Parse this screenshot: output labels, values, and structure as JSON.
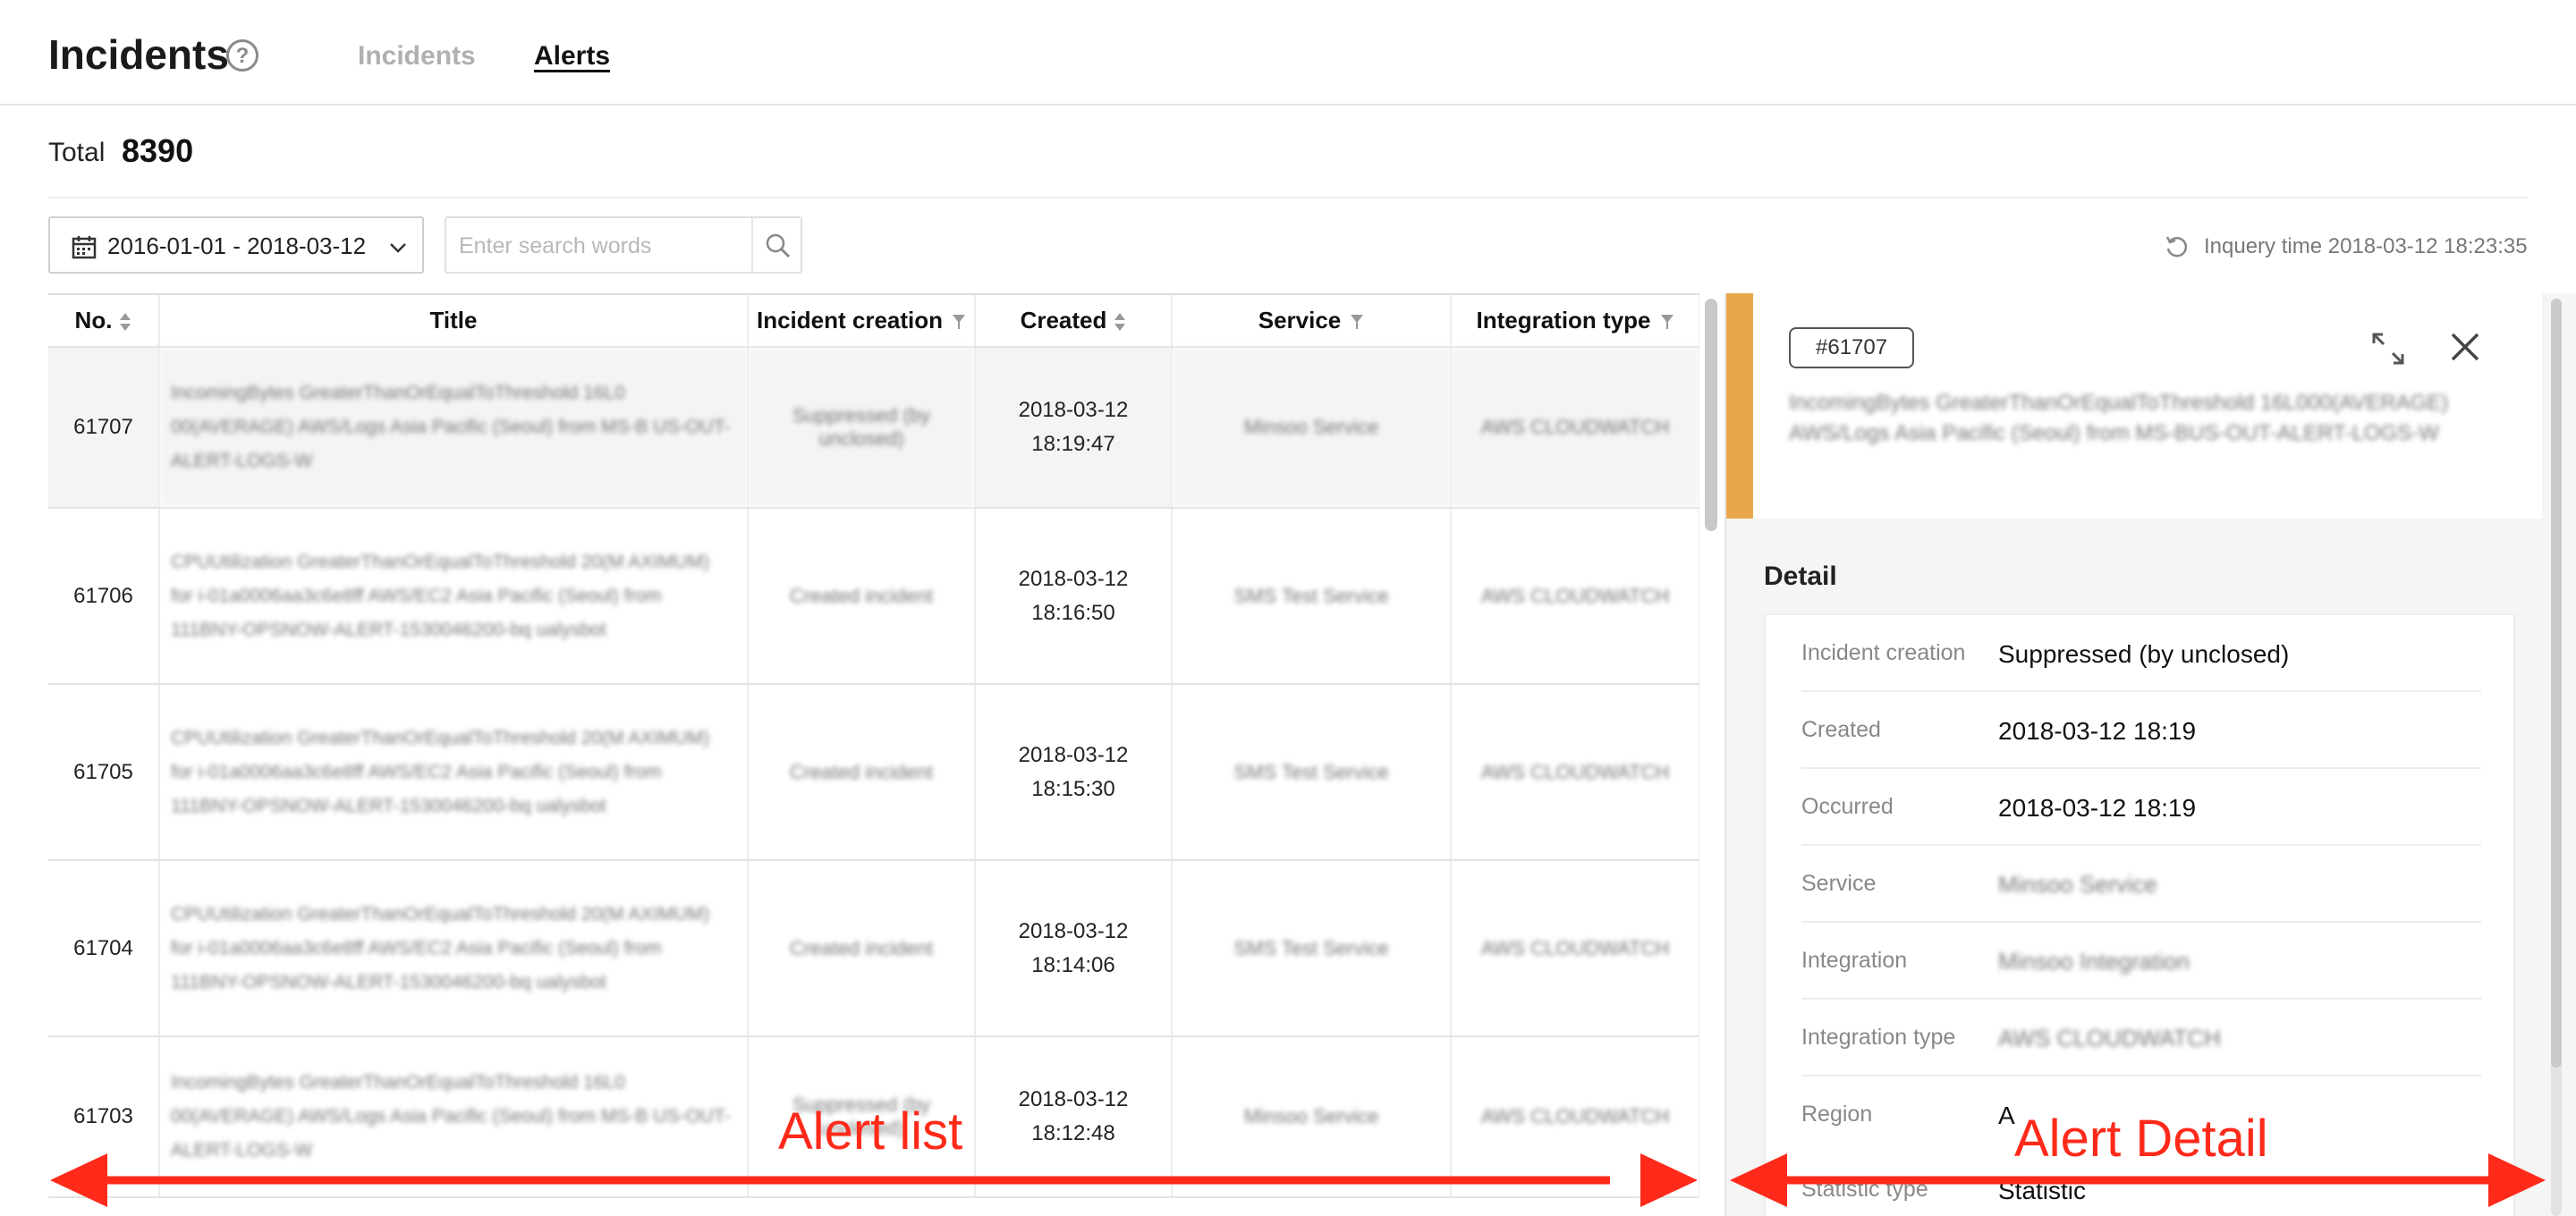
{
  "header": {
    "title": "Incidents",
    "help_icon": "?",
    "tabs": [
      {
        "label": "Incidents",
        "active": false
      },
      {
        "label": "Alerts",
        "active": true
      }
    ]
  },
  "total": {
    "label": "Total",
    "value": "8390"
  },
  "filters": {
    "date_range": "2016-01-01 - 2018-03-12",
    "search_placeholder": "Enter search words",
    "inquiry_time": "Inquery time 2018-03-12 18:23:35"
  },
  "table": {
    "columns": [
      "No.",
      "Title",
      "Incident creation",
      "Created",
      "Service",
      "Integration type"
    ],
    "rows": [
      {
        "no": "61707",
        "title": "IncomingBytes GreaterThanOrEqualToThreshold 16L0 00(AVERAGE) AWS/Logs Asia Pacific (Seoul) from MS-B US-OUT-ALERT-LOGS-W",
        "creation": "Suppressed (by unclosed)",
        "date": "2018-03-12",
        "time": "18:19:47",
        "service": "Minsoo Service",
        "integration": "AWS CLOUDWATCH"
      },
      {
        "no": "61706",
        "title": "CPUUtilization GreaterThanOrEqualToThreshold 20(M AXIMUM) for i-01a0006aa3c6e8ff AWS/EC2 Asia Pacific (Seoul) from 111BNY-OPSNOW-ALERT-1530046200-bq ualysbot",
        "creation": "Created incident",
        "date": "2018-03-12",
        "time": "18:16:50",
        "service": "SMS Test Service",
        "integration": "AWS CLOUDWATCH"
      },
      {
        "no": "61705",
        "title": "CPUUtilization GreaterThanOrEqualToThreshold 20(M AXIMUM) for i-01a0006aa3c6e8ff AWS/EC2 Asia Pacific (Seoul) from 111BNY-OPSNOW-ALERT-1530046200-bq ualysbot",
        "creation": "Created incident",
        "date": "2018-03-12",
        "time": "18:15:30",
        "service": "SMS Test Service",
        "integration": "AWS CLOUDWATCH"
      },
      {
        "no": "61704",
        "title": "CPUUtilization GreaterThanOrEqualToThreshold 20(M AXIMUM) for i-01a0006aa3c6e8ff AWS/EC2 Asia Pacific (Seoul) from 111BNY-OPSNOW-ALERT-1530046200-bq ualysbot",
        "creation": "Created incident",
        "date": "2018-03-12",
        "time": "18:14:06",
        "service": "SMS Test Service",
        "integration": "AWS CLOUDWATCH"
      },
      {
        "no": "61703",
        "title": "IncomingBytes GreaterThanOrEqualToThreshold 16L0 00(AVERAGE) AWS/Logs Asia Pacific (Seoul) from MS-B US-OUT-ALERT-LOGS-W",
        "creation": "Suppressed (by unclosed)",
        "date": "2018-03-12",
        "time": "18:12:48",
        "service": "Minsoo Service",
        "integration": "AWS CLOUDWATCH"
      }
    ]
  },
  "detail": {
    "incident_id": "#61707",
    "title": "IncomingBytes GreaterThanOrEqualToThreshold 16L000(AVERAGE) AWS/Logs Asia Pacific (Seoul) from MS-BUS-OUT-ALERT-LOGS-W",
    "heading": "Detail",
    "fields": [
      {
        "label": "Incident creation",
        "value": "Suppressed (by unclosed)"
      },
      {
        "label": "Created",
        "value": "2018-03-12 18:19"
      },
      {
        "label": "Occurred",
        "value": "2018-03-12 18:19"
      },
      {
        "label": "Service",
        "value": "Minsoo Service"
      },
      {
        "label": "Integration",
        "value": "Minsoo Integration"
      },
      {
        "label": "Integration type",
        "value": "AWS CLOUDWATCH"
      },
      {
        "label": "Region",
        "value": "A"
      },
      {
        "label": "Statistic type",
        "value": "Statistic"
      }
    ],
    "accent_color": "#e8a84a"
  },
  "annotations": {
    "alert_list": "Alert list",
    "alert_detail": "Alert Detail",
    "color": "#ff2a1a"
  },
  "icons": [
    "help-icon",
    "calendar-icon",
    "chevron-down-icon",
    "search-icon",
    "refresh-icon",
    "sort-icon",
    "filter-icon",
    "expand-icon",
    "close-icon"
  ]
}
